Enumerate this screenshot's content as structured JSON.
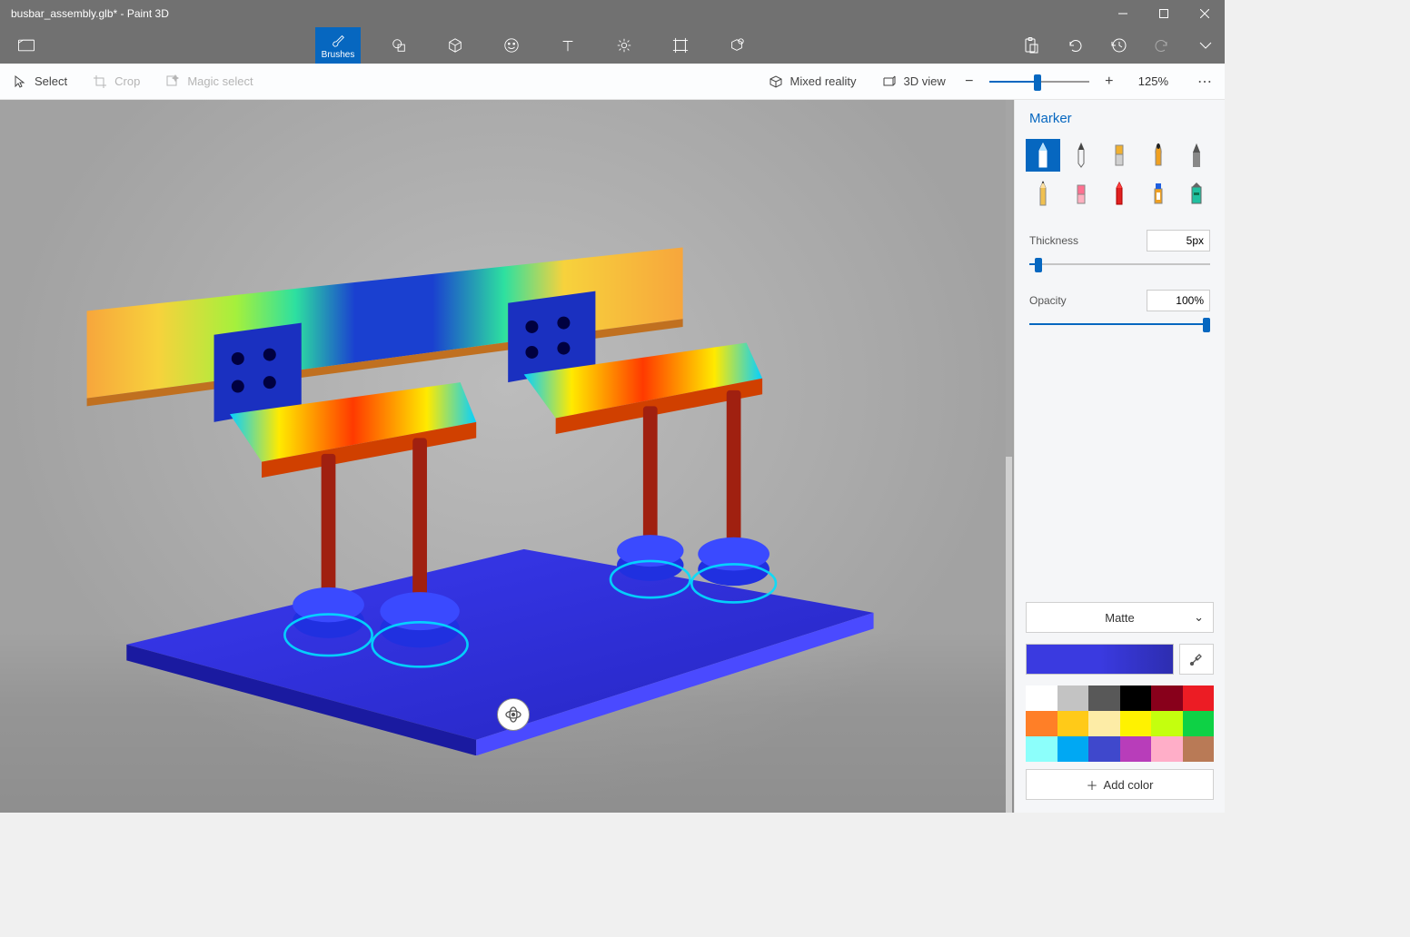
{
  "title": "busbar_assembly.glb* - Paint 3D",
  "tabs": {
    "brushes": "Brushes"
  },
  "subbar": {
    "select": "Select",
    "crop": "Crop",
    "magic": "Magic select",
    "mixed": "Mixed reality",
    "view3d": "3D view",
    "zoom_pct": "125%"
  },
  "panel": {
    "title": "Marker",
    "thickness_label": "Thickness",
    "thickness_value": "5px",
    "opacity_label": "Opacity",
    "opacity_value": "100%",
    "material": "Matte",
    "add_color": "Add color"
  },
  "palette": [
    "#ffffff",
    "#c3c3c3",
    "#585858",
    "#000000",
    "#88001b",
    "#ec1c24",
    "#ff7f27",
    "#ffca18",
    "#fdeca6",
    "#fff200",
    "#c4ff0e",
    "#0ed145",
    "#8cfffb",
    "#00a8f3",
    "#3f48cc",
    "#b83dba",
    "#ffaec8",
    "#b97a56"
  ],
  "current_color": "#3a3ae0"
}
